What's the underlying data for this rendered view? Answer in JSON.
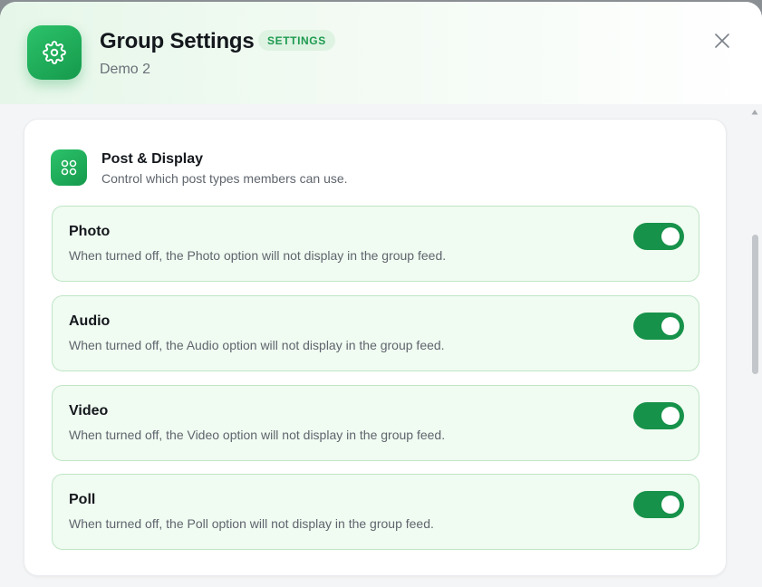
{
  "header": {
    "title": "Group Settings",
    "badge": "SETTINGS",
    "subtitle": "Demo 2",
    "icon": "gear-icon",
    "close_icon": "close-icon"
  },
  "section": {
    "icon": "grid-icon",
    "title": "Post & Display",
    "description": "Control which post types members can use."
  },
  "options": [
    {
      "title": "Photo",
      "description": "When turned off, the Photo option will not display in the group feed.",
      "enabled": true
    },
    {
      "title": "Audio",
      "description": "When turned off, the Audio option will not display in the group feed.",
      "enabled": true
    },
    {
      "title": "Video",
      "description": "When turned off, the Video option will not display in the group feed.",
      "enabled": true
    },
    {
      "title": "Poll",
      "description": "When turned off, the Poll option will not display in the group feed.",
      "enabled": true
    }
  ],
  "colors": {
    "accent": "#17924a",
    "badge_bg": "#dff3e3",
    "row_bg": "#f0fbf1",
    "row_border": "#bfe6c6"
  }
}
